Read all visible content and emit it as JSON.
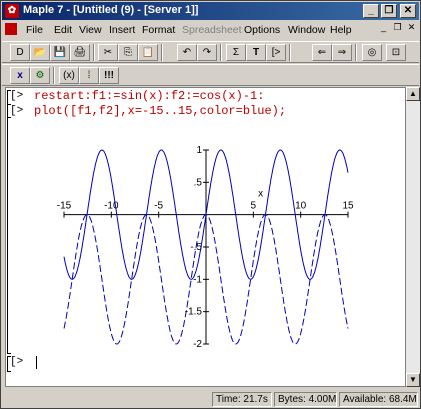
{
  "window": {
    "title": "Maple 7 - [Untitled (9) - [Server 1]]"
  },
  "title_buttons": [
    "_",
    "❐",
    "✕"
  ],
  "menu": [
    "File",
    "Edit",
    "View",
    "Insert",
    "Format",
    "Spreadsheet",
    "Options",
    "Window",
    "Help"
  ],
  "mdi_buttons": [
    "_",
    "❐",
    "✕"
  ],
  "toolbar1": [
    "D",
    "📂",
    "💾",
    "🖨",
    "✂",
    "⎘",
    "📋",
    "↶",
    "↷",
    "Σ",
    "T",
    "[>",
    "⇐",
    "⇒",
    "◎",
    "⊡"
  ],
  "toolbar2": [
    "x",
    "⚙",
    "(x)",
    "⁞",
    "!!!"
  ],
  "worksheet": {
    "lines": [
      {
        "prompt": "[>",
        "text": "restart:f1:=sin(x):f2:=cos(x)-1:"
      },
      {
        "prompt": "[>",
        "text": "plot([f1,f2],x=-15..15,color=blue);"
      }
    ],
    "empty_prompt": "[>"
  },
  "chart_data": {
    "type": "line",
    "series": [
      {
        "expr": "sin(x)"
      },
      {
        "expr": "cos(x)-1"
      }
    ],
    "xlim": [
      -15,
      15
    ],
    "ylim": [
      -2,
      1
    ],
    "xticks": [
      "-15",
      "-10",
      "-5",
      "0",
      "5",
      "10",
      "15"
    ],
    "yticks": [
      "1",
      ".5",
      "-.5",
      "-1",
      "-1.5",
      "-2"
    ],
    "xlabel": "x",
    "color": "#0000c0",
    "grid": false
  },
  "status": {
    "time": "Time: 21.7s",
    "bytes": "Bytes: 4.00M",
    "available": "Available: 68.4M"
  }
}
